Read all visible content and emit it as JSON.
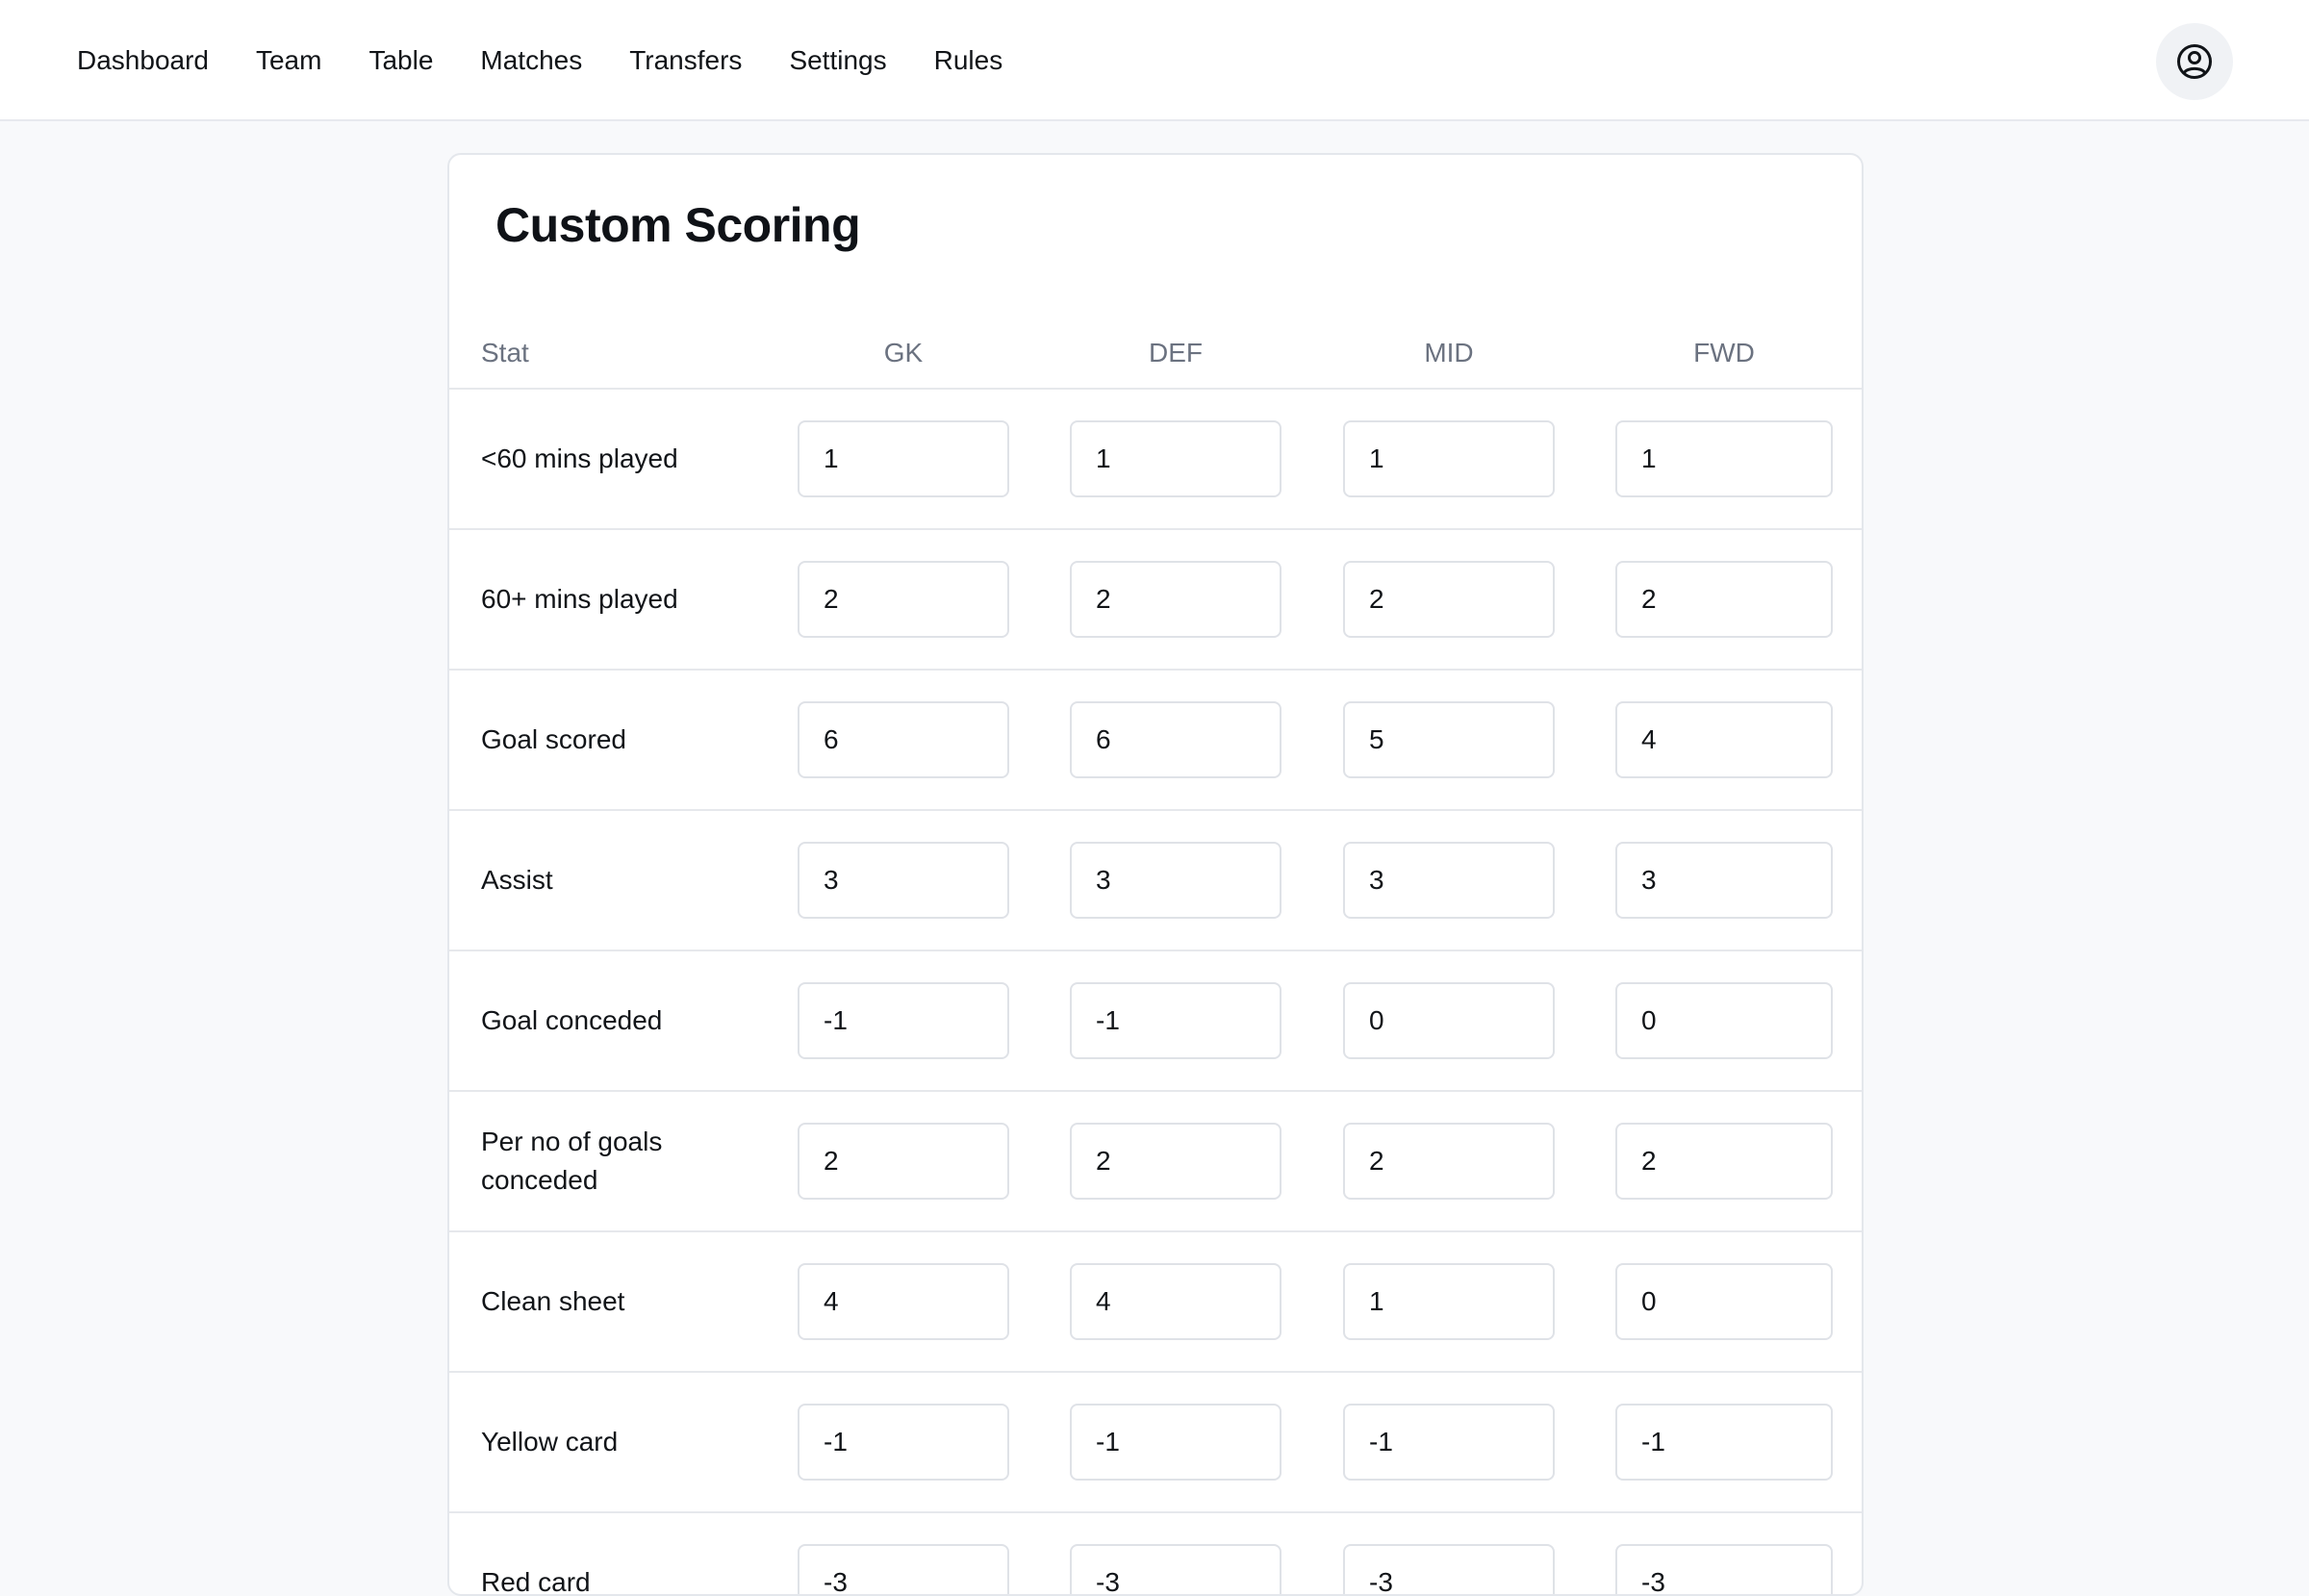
{
  "nav": {
    "items": [
      {
        "label": "Dashboard"
      },
      {
        "label": "Team"
      },
      {
        "label": "Table"
      },
      {
        "label": "Matches"
      },
      {
        "label": "Transfers"
      },
      {
        "label": "Settings"
      },
      {
        "label": "Rules"
      }
    ],
    "account_icon": "user-circle-icon"
  },
  "card": {
    "title": "Custom Scoring",
    "columns": [
      "Stat",
      "GK",
      "DEF",
      "MID",
      "FWD"
    ],
    "rows": [
      {
        "label": "<60 mins played",
        "values": [
          "1",
          "1",
          "1",
          "1"
        ]
      },
      {
        "label": "60+ mins played",
        "values": [
          "2",
          "2",
          "2",
          "2"
        ]
      },
      {
        "label": "Goal scored",
        "values": [
          "6",
          "6",
          "5",
          "4"
        ]
      },
      {
        "label": "Assist",
        "values": [
          "3",
          "3",
          "3",
          "3"
        ]
      },
      {
        "label": "Goal conceded",
        "values": [
          "-1",
          "-1",
          "0",
          "0"
        ]
      },
      {
        "label": "Per no of goals conceded",
        "values": [
          "2",
          "2",
          "2",
          "2"
        ]
      },
      {
        "label": "Clean sheet",
        "values": [
          "4",
          "4",
          "1",
          "0"
        ]
      },
      {
        "label": "Yellow card",
        "values": [
          "-1",
          "-1",
          "-1",
          "-1"
        ]
      },
      {
        "label": "Red card",
        "values": [
          "-3",
          "-3",
          "-3",
          "-3"
        ]
      }
    ]
  }
}
